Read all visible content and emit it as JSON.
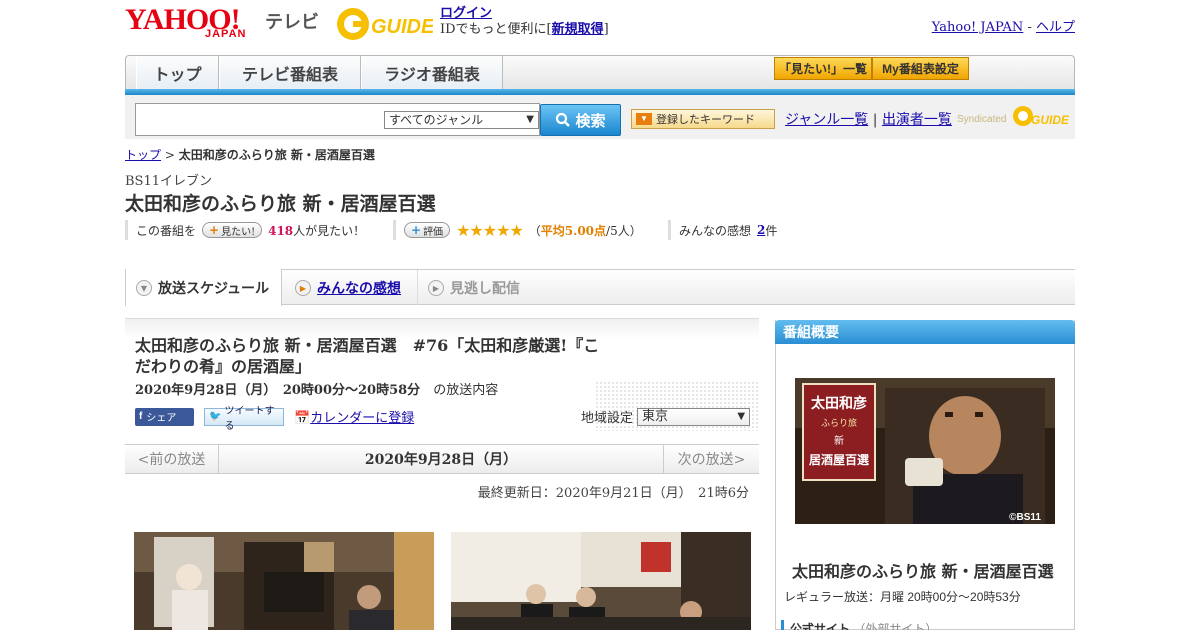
{
  "header": {
    "yahoo_logo": "YAHOO!",
    "japan_logo": "JAPAN",
    "tv_label": "テレビ",
    "gguide_logo": "G-GUIDE",
    "login_link": "ログイン",
    "login_prefix": "IDでもっと便利に[",
    "register_link": "新規取得",
    "login_suffix": "]",
    "yahoo_japan_link": "Yahoo! JAPAN",
    "separator": " - ",
    "help_link": "ヘルプ"
  },
  "nav": {
    "tabs": [
      "トップ",
      "テレビ番組表",
      "ラジオ番組表"
    ],
    "mitai_list": "「見たい!」一覧",
    "my_schedule": "My番組表設定"
  },
  "search": {
    "input_value": "",
    "genre_selected": "すべてのジャンル",
    "search_button": "検索",
    "keyword_button": "登録したキーワード",
    "genre_list_link": "ジャンル一覧",
    "divider": "|",
    "performer_list_link": "出演者一覧",
    "syndicated": "Syndicated",
    "syndicated_logo": "GUIDE"
  },
  "breadcrumb": {
    "home": "トップ",
    "sep": " > ",
    "current": "太田和彦のふらり旅 新・居酒屋百選"
  },
  "program": {
    "channel": "BS11イレブン",
    "title": "太田和彦のふらり旅 新・居酒屋百選",
    "mitai_prefix": "この番組を",
    "mitai_button": "見たい!",
    "mitai_count": "418",
    "mitai_suffix": "人が見たい！",
    "rating_button": "評価",
    "stars": "★★★★★",
    "rating_open": "（",
    "rating_avg": "平均5.00点",
    "rating_count": "/5人）",
    "comments_label": "みんなの感想",
    "comments_count": "2",
    "comments_suffix": "件"
  },
  "tabs": {
    "schedule": "放送スケジュール",
    "reviews": "みんなの感想",
    "streaming": "見逃し配信"
  },
  "episode": {
    "title": "太田和彦のふらり旅 新・居酒屋百選　#76「太田和彦厳選!『こだわりの肴』の居酒屋」",
    "date": "2020年9月28日（月）　20時00分～20時58分",
    "date_suffix": "の放送内容",
    "fb_button": "シェア",
    "tw_button": "ツイートする",
    "calendar_link": "カレンダーに登録",
    "region_label": "地域設定",
    "region_value": "東京",
    "prev": "<前の放送",
    "current_date": "2020年9月28日（月）",
    "next": "次の放送>",
    "updated": "最終更新日：2020年9月21日（月）　21時6分"
  },
  "sidebar": {
    "header": "番組概要",
    "image_credit": "©BS11",
    "image_sign": "太田和彦 ふらり旅 新 居酒屋百選",
    "title": "太田和彦のふらり旅 新・居酒屋百選",
    "regular": "レギュラー放送：月曜 20時00分～20時53分",
    "official": "公式サイト",
    "official_note": "（外部サイト）"
  },
  "colors": {
    "yahoo_red": "#e60012",
    "nav_blue": "#1b87c9",
    "rating_orange": "#e08000",
    "pink": "#d4145a"
  }
}
